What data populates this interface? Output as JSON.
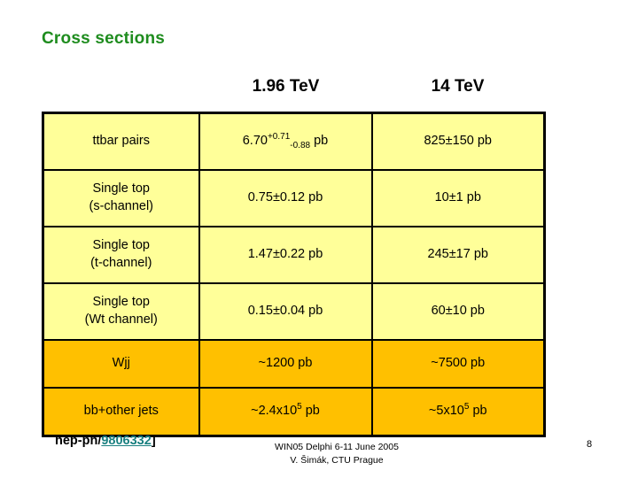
{
  "slide": {
    "title": "Cross sections",
    "page_number": "8",
    "colors": {
      "title_green": "#1e8c1e",
      "cell_yellow": "#ffff99",
      "cell_orange": "#ffc000",
      "link_teal": "#1a8080",
      "border_black": "#000000",
      "background": "#ffffff"
    }
  },
  "table": {
    "headers": [
      {
        "label": ""
      },
      {
        "label": "1.96 TeV"
      },
      {
        "label": "14 TeV"
      }
    ],
    "rows": [
      {
        "highlight": "yellow",
        "process_line1": "ttbar pairs",
        "process_line2": "",
        "value_1p96": {
          "base": "6.70",
          "sup": "+0.71",
          "sub": "-0.88",
          "unit": "pb"
        },
        "value_14": {
          "text": "825±150 pb"
        }
      },
      {
        "highlight": "yellow",
        "process_line1": "Single top",
        "process_line2": "(s-channel)",
        "value_1p96": {
          "text": "0.75±0.12 pb"
        },
        "value_14": {
          "text": "10±1 pb"
        }
      },
      {
        "highlight": "yellow",
        "process_line1": "Single top",
        "process_line2": "(t-channel)",
        "value_1p96": {
          "text": "1.47±0.22 pb"
        },
        "value_14": {
          "text": "245±17 pb"
        }
      },
      {
        "highlight": "yellow",
        "process_line1": "Single top",
        "process_line2": "(Wt channel)",
        "value_1p96": {
          "text": "0.15±0.04 pb"
        },
        "value_14": {
          "text": "60±10 pb"
        }
      },
      {
        "highlight": "orange",
        "process_line1": "Wjj",
        "process_line2": "",
        "value_1p96": {
          "text": "~1200 pb"
        },
        "value_14": {
          "text": "~7500 pb"
        }
      },
      {
        "highlight": "orange",
        "process_line1": "bb+other jets",
        "process_line2": "",
        "value_1p96": {
          "base": "~2.4x10",
          "exp": "5",
          "unit": "pb"
        },
        "value_14": {
          "base": "~5x10",
          "exp": "5",
          "unit": "pb"
        }
      }
    ]
  },
  "reference": {
    "prefix": "hep-ph/",
    "link_text": "9806332",
    "suffix": "]"
  },
  "footer": {
    "line1": "WIN05  Delphi 6-11 June 2005",
    "line2": "V. Šimák, CTU Prague"
  }
}
